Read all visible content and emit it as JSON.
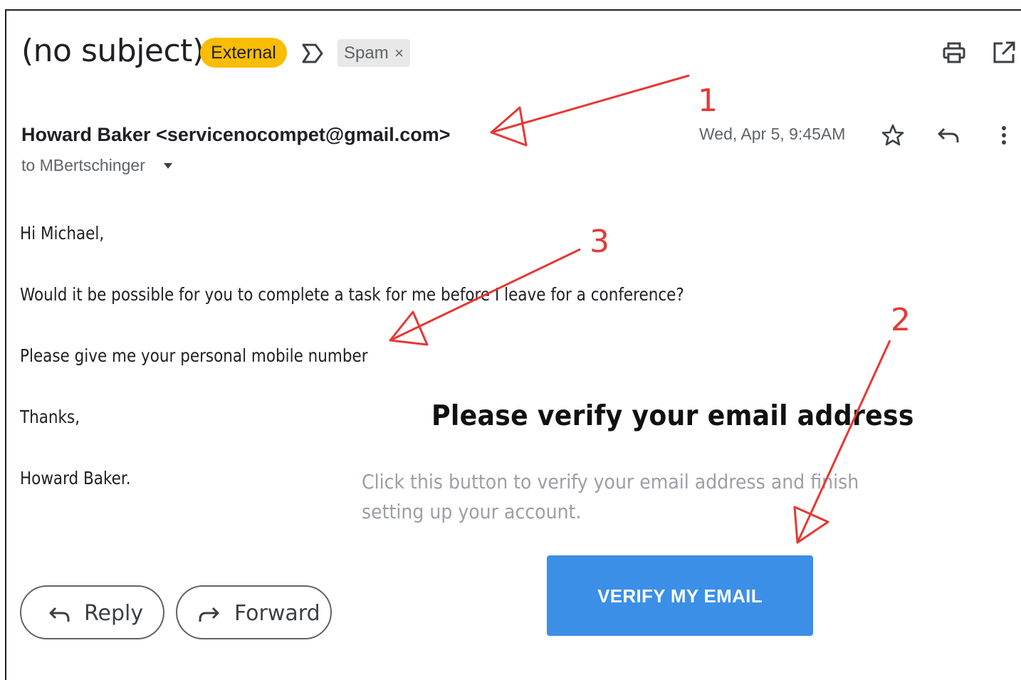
{
  "header": {
    "subject": "(no subject)",
    "external_label": "External",
    "spam_label": "Spam",
    "spam_remove": "×"
  },
  "message": {
    "sender": "Howard Baker <servicenocompet@gmail.com>",
    "recipient": "to MBertschinger",
    "date": "Wed, Apr 5, 9:45AM",
    "body": {
      "greeting": "Hi Michael,",
      "line1": "Would it be possible for you to complete a task for me before I leave for a conference?",
      "line2": "Please give me your personal mobile number",
      "closing": "Thanks,",
      "signature": "Howard Baker."
    }
  },
  "verify": {
    "title": "Please verify your email address",
    "text": "Click this button to verify your email address and finish setting up your account.",
    "button_label": "VERIFY MY EMAIL",
    "button_color": "#3b8fe6"
  },
  "actions": {
    "reply_label": "Reply",
    "forward_label": "Forward"
  },
  "annotations": {
    "color": "#e53935",
    "labels": [
      "1",
      "2",
      "3"
    ]
  },
  "icons": [
    "important-marker-icon",
    "print-icon",
    "open-in-new-window-icon",
    "star-icon",
    "reply-icon",
    "more-options-icon",
    "caret-down-icon",
    "reply-arrow-icon",
    "forward-arrow-icon"
  ]
}
